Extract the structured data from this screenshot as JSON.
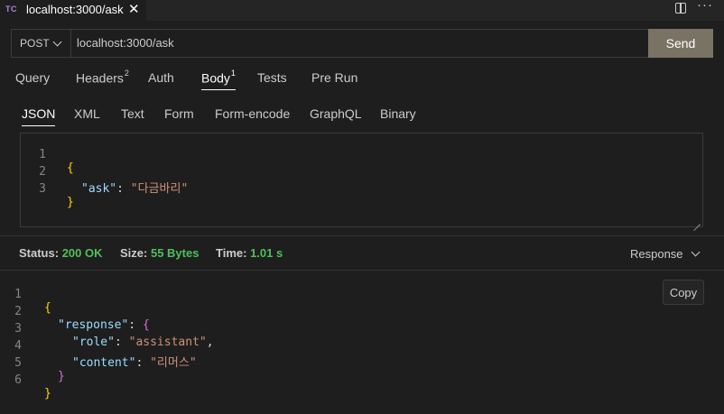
{
  "tab": {
    "badge": "TC",
    "title": "localhost:3000/ask",
    "close": "✕"
  },
  "window_actions": {
    "more": "···"
  },
  "request": {
    "method": "POST",
    "url": "localhost:3000/ask",
    "send_label": "Send"
  },
  "main_tabs": [
    {
      "label": "Query",
      "count": ""
    },
    {
      "label": "Headers",
      "count": "2"
    },
    {
      "label": "Auth",
      "count": ""
    },
    {
      "label": "Body",
      "count": "1"
    },
    {
      "label": "Tests",
      "count": ""
    },
    {
      "label": "Pre Run",
      "count": ""
    }
  ],
  "body_tabs": [
    "JSON",
    "XML",
    "Text",
    "Form",
    "Form-encode",
    "GraphQL",
    "Binary"
  ],
  "request_body": {
    "line_numbers": [
      "1",
      "2",
      "3"
    ],
    "open_brace": "{",
    "key": "\"ask\"",
    "colon": ": ",
    "value": "\"다금바리\"",
    "close_brace": "}"
  },
  "status": {
    "status_label": "Status:",
    "status_value": "200 OK",
    "size_label": "Size:",
    "size_value": "55 Bytes",
    "time_label": "Time:",
    "time_value": "1.01 s",
    "view_select": "Response"
  },
  "response_body": {
    "line_numbers": [
      "1",
      "2",
      "3",
      "4",
      "5",
      "6"
    ],
    "open_brace": "{",
    "response_key": "\"response\"",
    "response_open": "{",
    "role_key": "\"role\"",
    "role_value": "\"assistant\"",
    "content_key": "\"content\"",
    "content_value": "\"리머스\"",
    "inner_close": "}",
    "outer_close": "}",
    "copy_label": "Copy"
  },
  "colors": {
    "accent_send": "#7a7262",
    "status_ok": "#4ec05a",
    "json_key": "#9cdcfe",
    "json_string": "#ce9178"
  }
}
